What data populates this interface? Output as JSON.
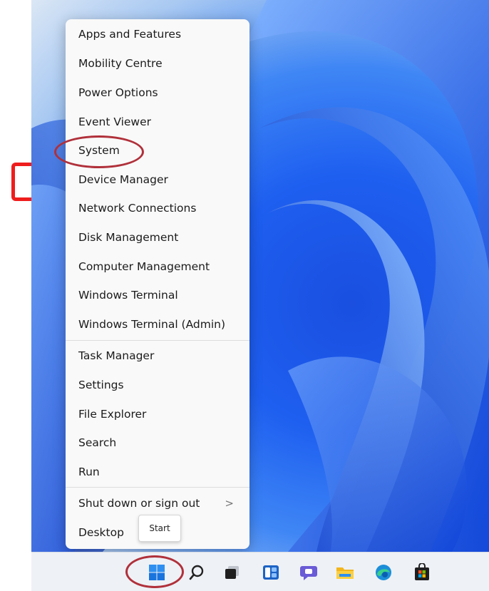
{
  "menu": {
    "groups": [
      {
        "items": [
          "Apps and Features",
          "Mobility Centre",
          "Power Options",
          "Event Viewer",
          "System",
          "Device Manager",
          "Network Connections",
          "Disk Management",
          "Computer Management",
          "Windows Terminal",
          "Windows Terminal (Admin)"
        ]
      },
      {
        "items": [
          "Task Manager",
          "Settings",
          "File Explorer",
          "Search",
          "Run"
        ]
      },
      {
        "items": [
          "Shut down or sign out",
          "Desktop"
        ]
      }
    ],
    "submenu_glyph": ">"
  },
  "tooltip": {
    "text": "Start"
  },
  "taskbar": {
    "icons": [
      "windows-start-icon",
      "search-icon",
      "task-view-icon",
      "widgets-icon",
      "chat-icon",
      "file-explorer-icon",
      "edge-icon",
      "store-icon"
    ]
  },
  "annotations": {
    "color": "#b0303a",
    "bracket_color": "#ef1d1d"
  }
}
